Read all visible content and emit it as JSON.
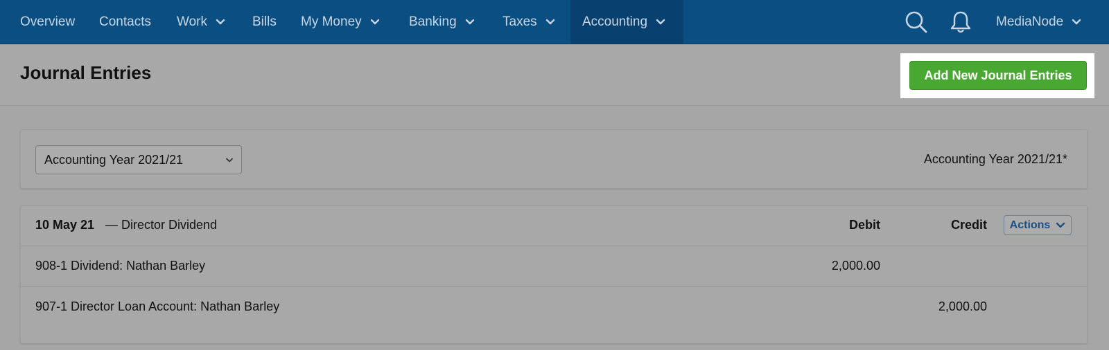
{
  "nav": {
    "items": [
      {
        "label": "Overview",
        "dropdown": false
      },
      {
        "label": "Contacts",
        "dropdown": false
      },
      {
        "label": "Work",
        "dropdown": true
      },
      {
        "label": "Bills",
        "dropdown": false
      },
      {
        "label": "My Money",
        "dropdown": true
      },
      {
        "label": "Banking",
        "dropdown": true
      },
      {
        "label": "Taxes",
        "dropdown": true
      },
      {
        "label": "Accounting",
        "dropdown": true,
        "active": true
      }
    ],
    "account_label": "MediaNode",
    "icons": [
      "search-icon",
      "bell-icon",
      "chevron-down-icon"
    ]
  },
  "header": {
    "title": "Journal Entries",
    "add_button_label": "Add New Journal Entries"
  },
  "filter": {
    "selected_year": "Accounting Year 2021/21",
    "current_year_label": "Accounting Year 2021/21*"
  },
  "journal": {
    "date": "10 May 21",
    "separator": "—",
    "description": "Director Dividend",
    "debit_header": "Debit",
    "credit_header": "Credit",
    "actions_label": "Actions",
    "lines": [
      {
        "account": "908-1 Dividend: Nathan Barley",
        "debit": "2,000.00",
        "credit": ""
      },
      {
        "account": "907-1 Director Loan Account: Nathan Barley",
        "debit": "",
        "credit": "2,000.00"
      }
    ]
  },
  "colors": {
    "nav_bg": "#0b4f82",
    "nav_active_bg": "#084170",
    "primary_button": "#48a832",
    "link_blue": "#1a4f86",
    "overlay_page": "#a8a8a8"
  }
}
